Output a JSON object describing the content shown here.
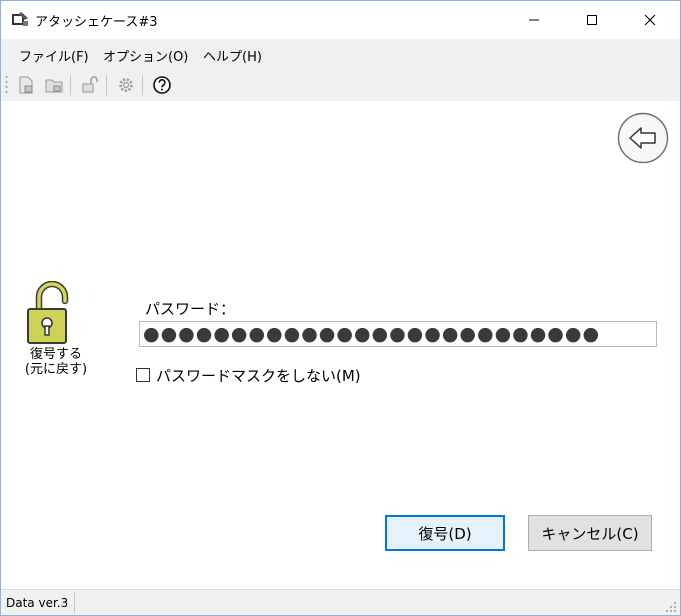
{
  "window": {
    "title": "アタッシェケース#3"
  },
  "menu": {
    "items": [
      {
        "label": "ファイル(F)"
      },
      {
        "label": "オプション(O)"
      },
      {
        "label": "ヘルプ(H)"
      }
    ]
  },
  "toolbar": {
    "icons": [
      "encrypt-file-icon",
      "decrypt-file-icon",
      "open-folder-icon",
      "settings-icon",
      "help-icon"
    ]
  },
  "main": {
    "lock_caption_line1": "復号する",
    "lock_caption_line2": "(元に戻す)",
    "password_label": "パスワード：",
    "password_value": "●●●●●●●●●●●●●●●●●●●●●●●●●●",
    "mask_checkbox_label": "パスワードマスクをしない(M)",
    "mask_checked": false
  },
  "buttons": {
    "decrypt": "復号(D)",
    "cancel": "キャンセル(C)"
  },
  "status": {
    "text": "Data ver.3"
  },
  "colors": {
    "accent": "#0078d7",
    "lock_body": "#cfd256",
    "chrome": "#f0f0f0"
  }
}
